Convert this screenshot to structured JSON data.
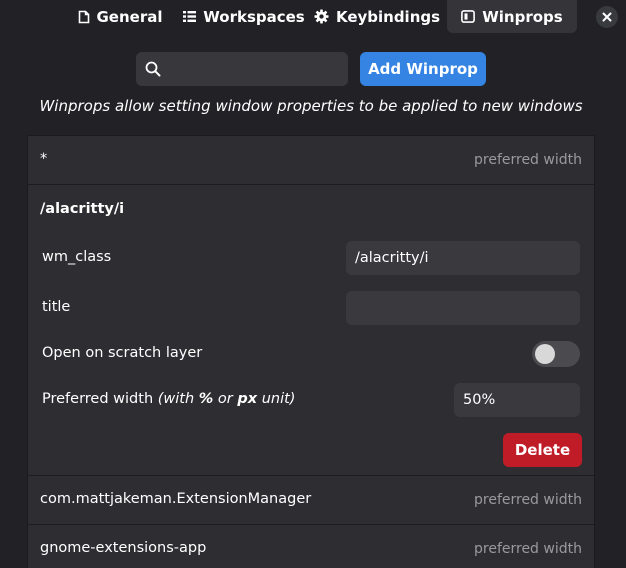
{
  "tabs": [
    {
      "label": "General",
      "icon": "document-icon"
    },
    {
      "label": "Workspaces",
      "icon": "list-icon"
    },
    {
      "label": "Keybindings",
      "icon": "gear-icon"
    },
    {
      "label": "Winprops",
      "icon": "window-icon",
      "active": true
    }
  ],
  "search": {
    "placeholder": "",
    "value": ""
  },
  "add_button": "Add Winprop",
  "description": "Winprops allow setting window properties to be applied to new windows",
  "rows": [
    {
      "name": "*",
      "hint": "preferred width"
    },
    {
      "name": "com.mattjakeman.ExtensionManager",
      "hint": "preferred width"
    },
    {
      "name": "gnome-extensions-app",
      "hint": "preferred width"
    }
  ],
  "expanded": {
    "title": "/alacritty/i",
    "wm_class_label": "wm_class",
    "wm_class_value": "/alacritty/i",
    "title_label": "title",
    "title_value": "",
    "scratch_label": "Open on scratch layer",
    "scratch_on": false,
    "pw_label_pre": "Preferred width ",
    "pw_label_with": "(with ",
    "pw_pct": "%",
    "pw_or": " or ",
    "pw_px": "px",
    "pw_unit": " unit)",
    "pw_value": "50%",
    "delete_label": "Delete"
  },
  "colors": {
    "background": "#222226",
    "accent": "#3584e4",
    "destructive": "#c01c28"
  }
}
